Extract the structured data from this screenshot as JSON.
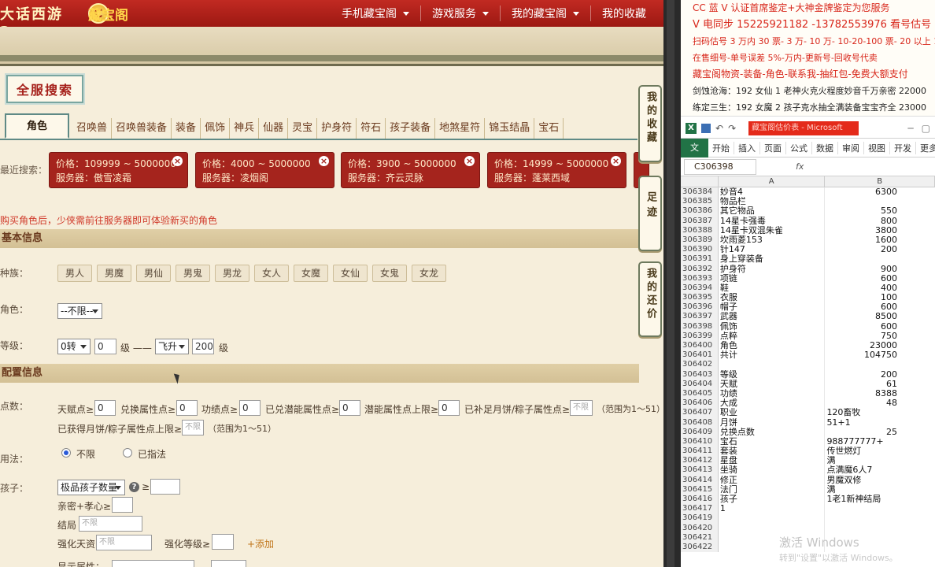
{
  "header": {
    "logo_game": "大话西游2",
    "logo_coin": "C",
    "logo_site": "藏宝阁",
    "nav": [
      "手机藏宝阁",
      "游戏服务",
      "我的藏宝阁",
      "我的收藏"
    ]
  },
  "search_title": "全服搜索",
  "tabs": [
    "角色",
    "召唤兽",
    "召唤兽装备",
    "装备",
    "佩饰",
    "神兵",
    "仙器",
    "灵宝",
    "护身符",
    "符石",
    "孩子装备",
    "地煞星符",
    "锦玉结晶",
    "宝石"
  ],
  "recent_label": "最近搜索：",
  "recent_chips": [
    {
      "price": "价格：109999 ~ 5000000",
      "server": "服务器：傲雪凌霜"
    },
    {
      "price": "价格：4000 ~ 5000000",
      "server": "服务器：凌烟阁"
    },
    {
      "price": "价格：3900 ~ 5000000",
      "server": "服务器：齐云灵脉"
    },
    {
      "price": "价格：14999 ~ 5000000",
      "server": "服务器：蓬莱西域"
    }
  ],
  "notice": "购买角色后，少侠需前往服务器即可体验新买的角色",
  "sections": {
    "basic": "基本信息",
    "config": "配置信息"
  },
  "basic": {
    "race_label": "种族：",
    "races": [
      "男人",
      "男魔",
      "男仙",
      "男鬼",
      "男龙",
      "女人",
      "女魔",
      "女仙",
      "女鬼",
      "女龙"
    ],
    "role_label": "角色：",
    "role_value": "--不限--",
    "level_label": "等级：",
    "level_from_turn": "0转",
    "level_from": "0",
    "level_unit1": "级 ——",
    "level_to_turn": "飞升",
    "level_to": "200",
    "level_unit2": "级"
  },
  "config": {
    "points_label": "点数：",
    "points_items": [
      "天赋点≥",
      "兑换属性点≥",
      "功绩点≥",
      "已兑潜能属性点≥",
      "潜能属性点上限≥",
      "已补足月饼/粽子属性点≥"
    ],
    "points_values": [
      "0",
      "0",
      "0",
      "0",
      "0",
      "不限"
    ],
    "range1": "（范围为1～51）",
    "second_line_label": "已获得月饼/粽子属性点上限≥",
    "second_line_value": "不限",
    "range2": "（范围为1～51）",
    "method_label": "用法：",
    "method_options": [
      "不限",
      "已指法"
    ],
    "child_label": "孩子：",
    "child_select": "极品孩子数量",
    "child_ge": "≥",
    "intimacy_label": "亲密+孝心≥",
    "ending_label": "结局",
    "ending_ph": "不限",
    "talent_label": "强化天资",
    "talent_ph": "不限",
    "enhance_label": "强化等级≥",
    "add_link": "+添加",
    "other_label": "显示属性："
  },
  "side_buttons": [
    "我的收藏",
    "足迹",
    "我的还价"
  ],
  "messages": [
    {
      "text": "CC 蓝 V 认证首席鉴定+大神金牌鉴定为您服务",
      "color": "#d8261a"
    },
    {
      "text": "V 电同步 15225921182 -13782553976 看号估号",
      "color": "#d8261a"
    },
    {
      "text": "扫码估号 3 万内 30 票- 3 万- 10 万- 10-20-100 票- 20 以上 150",
      "color": "#d8261a"
    },
    {
      "text": "在售细号-单号误差 5%-万内-更新号-回收号代卖",
      "color": "#d8261a"
    },
    {
      "text": "藏宝阁物资-装备-角色-联系我-抽红包-免费大额支付",
      "color": "#d8261a"
    },
    {
      "text": "剑蚀沧海：192 女仙 1 老神火克火程度妙音千万亲密 22000",
      "color": "#222"
    },
    {
      "text": "练定三生：192 女魔 2 孩子克水抽全满装备宝宝齐全 23000",
      "color": "#222"
    }
  ],
  "excel": {
    "icon": "X",
    "title_bar": "藏宝阁估价表 - Microsoft",
    "file_tab": "文件",
    "ribbon_tabs": [
      "开始",
      "插入",
      "页面",
      "公式",
      "数据",
      "审阅",
      "视图",
      "开发",
      "更多"
    ],
    "cell_ref": "C306398",
    "fx": "fx",
    "col_a": "A",
    "col_b": "B",
    "rows": [
      {
        "n": "306384",
        "a": "妙音4",
        "b": "6300",
        "num": true
      },
      {
        "n": "306385",
        "a": "物品栏",
        "b": "",
        "num": false
      },
      {
        "n": "306386",
        "a": "其它物品",
        "b": "550",
        "num": true
      },
      {
        "n": "306387",
        "a": "14星卡强毒",
        "b": "800",
        "num": true
      },
      {
        "n": "306388",
        "a": "14星卡双混朱雀",
        "b": "3800",
        "num": true
      },
      {
        "n": "306389",
        "a": "坎雨菱153",
        "b": "1600",
        "num": true
      },
      {
        "n": "306390",
        "a": "针147",
        "b": "200",
        "num": true
      },
      {
        "n": "306391",
        "a": "身上穿装备",
        "b": "",
        "num": false
      },
      {
        "n": "306392",
        "a": "护身符",
        "b": "900",
        "num": true
      },
      {
        "n": "306393",
        "a": "项链",
        "b": "600",
        "num": true
      },
      {
        "n": "306394",
        "a": "鞋",
        "b": "400",
        "num": true
      },
      {
        "n": "306395",
        "a": "衣服",
        "b": "100",
        "num": true
      },
      {
        "n": "306396",
        "a": "帽子",
        "b": "600",
        "num": true
      },
      {
        "n": "306397",
        "a": "武器",
        "b": "8500",
        "num": true
      },
      {
        "n": "306398",
        "a": "佩饰",
        "b": "600",
        "num": true
      },
      {
        "n": "306399",
        "a": "点粹",
        "b": "750",
        "num": true
      },
      {
        "n": "306400",
        "a": "角色",
        "b": "23000",
        "num": true
      },
      {
        "n": "306401",
        "a": "共计",
        "b": "104750",
        "num": true
      },
      {
        "n": "306402",
        "a": "",
        "b": "",
        "num": false
      },
      {
        "n": "306403",
        "a": "等级",
        "b": "200",
        "num": true
      },
      {
        "n": "306404",
        "a": "天赋",
        "b": "61",
        "num": true
      },
      {
        "n": "306405",
        "a": "功绩",
        "b": "8388",
        "num": true
      },
      {
        "n": "306406",
        "a": "大成",
        "b": "48",
        "num": true
      },
      {
        "n": "306407",
        "a": "职业",
        "b": "120畜牧",
        "num": false
      },
      {
        "n": "306408",
        "a": "月饼",
        "b": "51+1",
        "num": false
      },
      {
        "n": "306409",
        "a": "兑换点数",
        "b": "25",
        "num": true
      },
      {
        "n": "306410",
        "a": "宝石",
        "b": "988777777+",
        "num": false
      },
      {
        "n": "306411",
        "a": "套装",
        "b": "传世燃灯",
        "num": false
      },
      {
        "n": "306412",
        "a": "星盘",
        "b": "满",
        "num": false
      },
      {
        "n": "306413",
        "a": "坐骑",
        "b": "点满魔6人7",
        "num": false
      },
      {
        "n": "306414",
        "a": "修正",
        "b": "男魔双修",
        "num": false
      },
      {
        "n": "306415",
        "a": "法门",
        "b": "满",
        "num": false
      },
      {
        "n": "306416",
        "a": "孩子",
        "b": "1老1新神结局",
        "num": false
      },
      {
        "n": "306417",
        "a": "1",
        "b": "",
        "num": false
      },
      {
        "n": "306419",
        "a": "",
        "b": "",
        "num": false
      },
      {
        "n": "306420",
        "a": "",
        "b": "",
        "num": false
      },
      {
        "n": "306421",
        "a": "",
        "b": "",
        "num": false
      },
      {
        "n": "306422",
        "a": "",
        "b": "",
        "num": false
      }
    ]
  },
  "watermark": {
    "line1": "激活 Windows",
    "line2": "转到\"设置\"以激活 Windows。"
  }
}
